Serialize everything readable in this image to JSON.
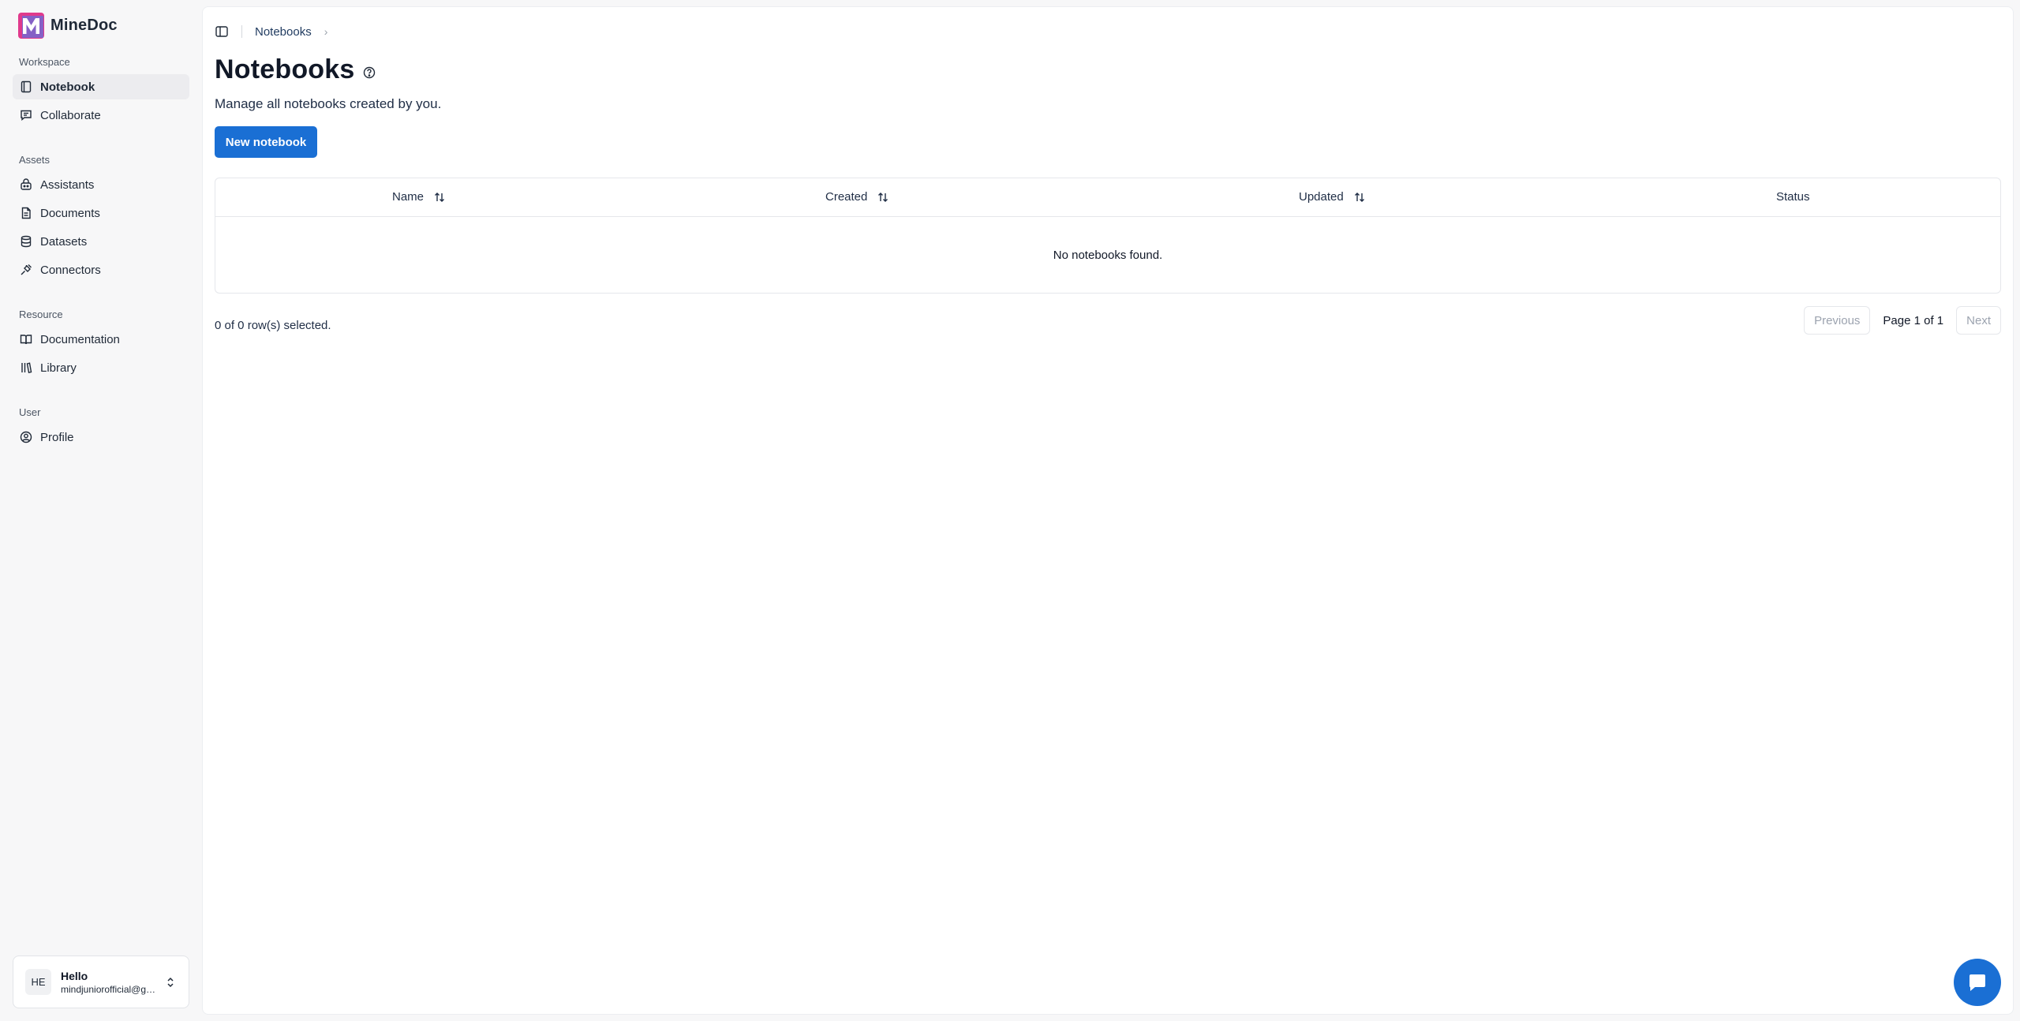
{
  "brand": {
    "name": "MineDoc",
    "logo_color": "#e03a8c"
  },
  "sidebar": {
    "sections": [
      {
        "label": "Workspace",
        "items": [
          {
            "label": "Notebook",
            "icon": "notebook-icon",
            "active": true
          },
          {
            "label": "Collaborate",
            "icon": "chat-icon"
          }
        ]
      },
      {
        "label": "Assets",
        "items": [
          {
            "label": "Assistants",
            "icon": "bot-icon"
          },
          {
            "label": "Documents",
            "icon": "document-icon"
          },
          {
            "label": "Datasets",
            "icon": "database-icon"
          },
          {
            "label": "Connectors",
            "icon": "plug-icon"
          }
        ]
      },
      {
        "label": "Resource",
        "items": [
          {
            "label": "Documentation",
            "icon": "book-open-icon"
          },
          {
            "label": "Library",
            "icon": "library-icon"
          }
        ]
      },
      {
        "label": "User",
        "items": [
          {
            "label": "Profile",
            "icon": "user-circle-icon"
          }
        ]
      }
    ],
    "user": {
      "initials": "HE",
      "name": "Hello",
      "email": "mindjuniorofficial@gmail.com"
    }
  },
  "breadcrumb": {
    "current": "Notebooks",
    "separator": "›"
  },
  "page": {
    "title": "Notebooks",
    "subtitle": "Manage all notebooks created by you.",
    "new_button": "New notebook"
  },
  "table": {
    "columns": [
      {
        "label": "Name",
        "sortable": true
      },
      {
        "label": "Created",
        "sortable": true
      },
      {
        "label": "Updated",
        "sortable": true
      },
      {
        "label": "Status",
        "sortable": false
      }
    ],
    "empty_message": "No notebooks found."
  },
  "footer": {
    "selection": "0 of 0 row(s) selected.",
    "previous": "Previous",
    "page_info": "Page 1 of 1",
    "next": "Next"
  },
  "colors": {
    "primary": "#1a6fd4",
    "sidebar_bg": "#f7f7f8"
  }
}
